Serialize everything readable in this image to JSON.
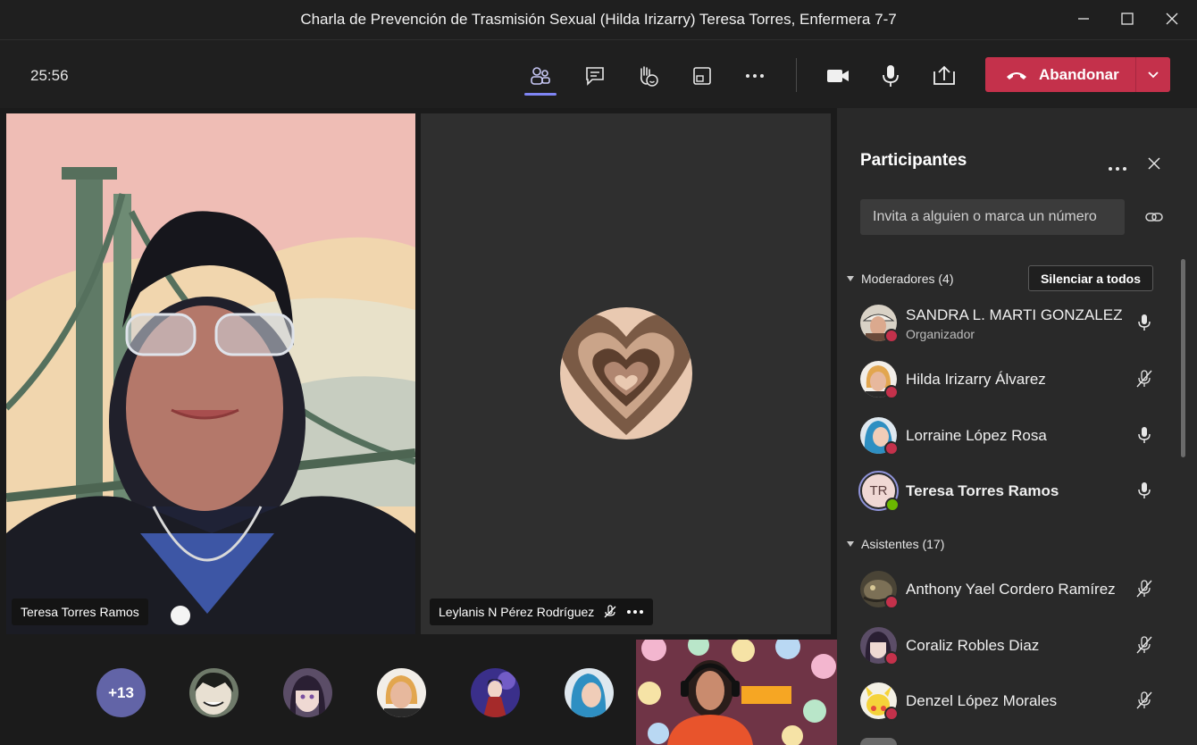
{
  "window": {
    "title": "Charla de Prevención de Trasmisión Sexual (Hilda Irizarry) Teresa Torres, Enfermera 7-7"
  },
  "toolbar": {
    "timer": "25:56",
    "leave_label": "Abandonar"
  },
  "stage": {
    "tiles": [
      {
        "name": "Teresa Torres Ramos"
      },
      {
        "name": "Leylanis N Pérez Rodríguez",
        "muted": true
      }
    ],
    "more_count": "+13"
  },
  "panel": {
    "title": "Participantes",
    "invite_placeholder": "Invita a alguien o marca un número",
    "moderators_label": "Moderadores (4)",
    "mute_all_label": "Silenciar a todos",
    "attendees_label": "Asistentes (17)",
    "moderators": [
      {
        "name": "SANDRA L. MARTI GONZALEZ",
        "role": "Organizador",
        "muted": false
      },
      {
        "name": "Hilda Irizarry Álvarez",
        "muted": true
      },
      {
        "name": "Lorraine López Rosa",
        "muted": false
      },
      {
        "name": "Teresa Torres Ramos",
        "initials": "TR",
        "muted": false,
        "bold": true
      }
    ],
    "attendees": [
      {
        "name": "Anthony Yael Cordero Ramírez",
        "muted": true
      },
      {
        "name": "Coraliz Robles Diaz",
        "muted": true
      },
      {
        "name": "Denzel López Morales",
        "muted": true
      }
    ]
  },
  "colors": {
    "accent": "#6264a7",
    "leave": "#c4314b",
    "busy": "#c4314b",
    "available": "#6bb700"
  }
}
